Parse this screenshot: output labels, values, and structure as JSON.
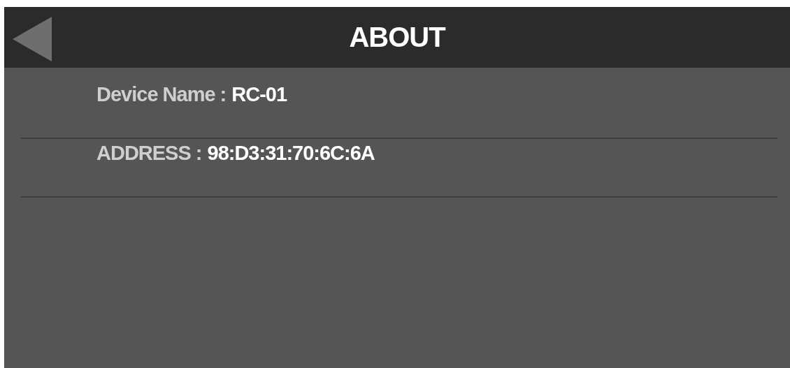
{
  "header": {
    "title": "ABOUT"
  },
  "info_rows": [
    {
      "label": "Device Name :",
      "value": "RC-01"
    },
    {
      "label": "ADDRESS :",
      "value": "98:D3:31:70:6C:6A"
    }
  ]
}
